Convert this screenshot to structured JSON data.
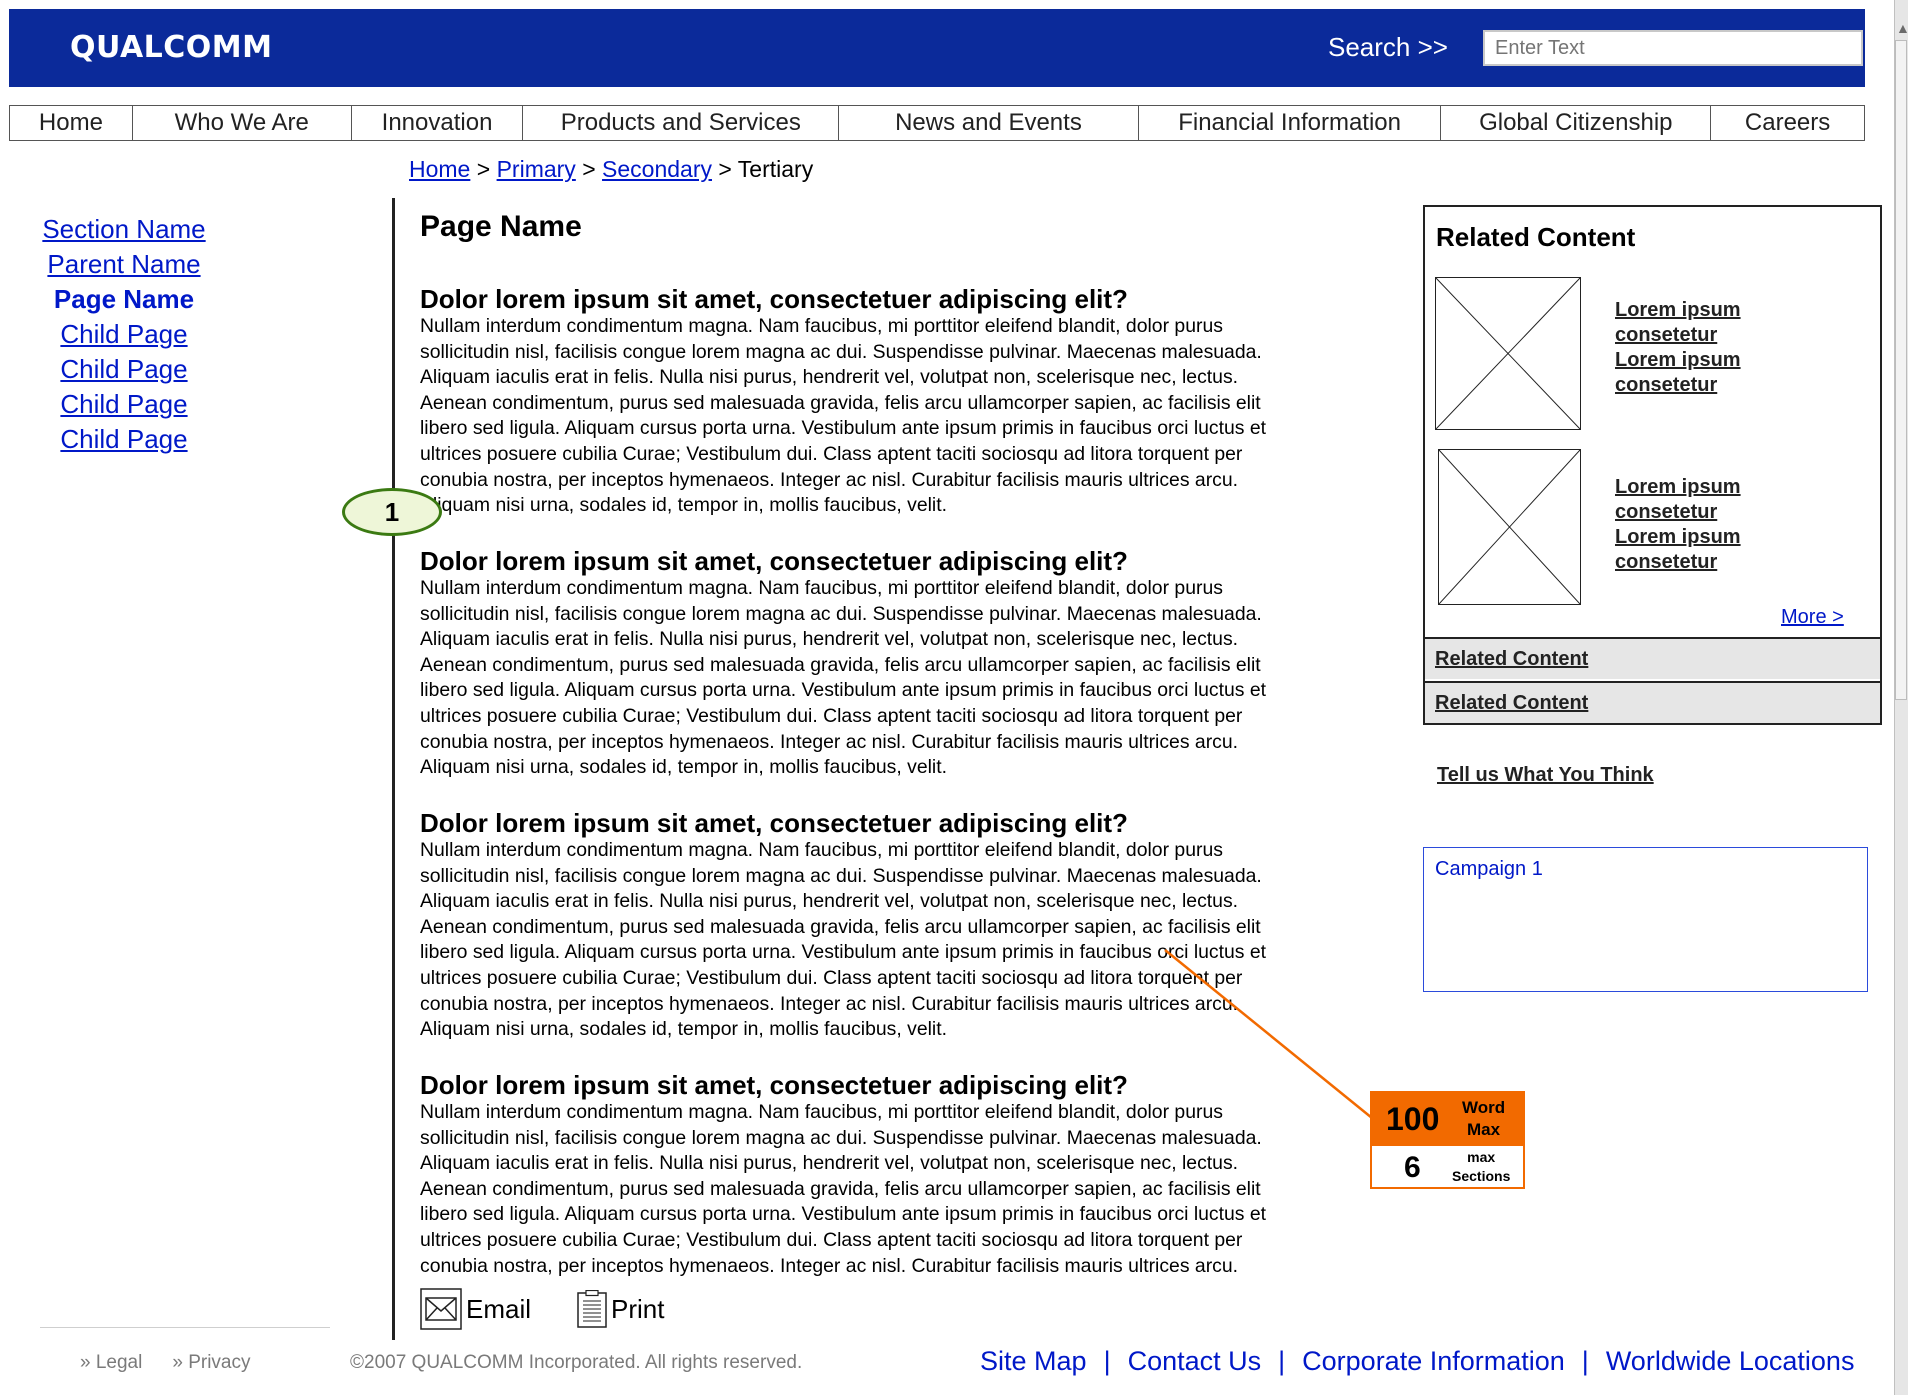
{
  "header": {
    "logo": "QUALCOMM",
    "search_label": "Search  >>",
    "search_placeholder": "Enter Text"
  },
  "nav": [
    {
      "label": "Home"
    },
    {
      "label": "Who We Are"
    },
    {
      "label": "Innovation"
    },
    {
      "label": "Products and Services"
    },
    {
      "label": "News and Events"
    },
    {
      "label": "Financial Information"
    },
    {
      "label": "Global Citizenship"
    },
    {
      "label": "Careers"
    }
  ],
  "breadcrumb": {
    "home": "Home",
    "primary": "Primary",
    "secondary": "Secondary",
    "tertiary": "Tertiary",
    "sep": " > "
  },
  "leftnav": {
    "section": "Section Name",
    "parent": "Parent Name",
    "current": "Page Name",
    "children": [
      "Child Page",
      "Child Page",
      "Child Page",
      "Child Page"
    ]
  },
  "main": {
    "page_title": "Page Name",
    "sections": [
      {
        "heading": "Dolor lorem ipsum sit amet, consectetuer adipiscing elit?",
        "lines": [
          "Nullam interdum condimentum magna. Nam faucibus, mi porttitor eleifend blandit, dolor purus",
          "sollicitudin nisl, facilisis congue lorem magna ac dui. Suspendisse pulvinar. Maecenas malesuada.",
          "Aliquam iaculis erat in felis. Nulla nisi purus, hendrerit vel, volutpat non, scelerisque nec, lectus.",
          "Aenean condimentum, purus sed malesuada gravida, felis arcu ullamcorper sapien, ac facilisis elit",
          "libero sed ligula. Aliquam cursus porta urna. Vestibulum ante ipsum primis in faucibus orci luctus et",
          "ultrices posuere cubilia Curae; Vestibulum dui. Class aptent taciti sociosqu ad litora torquent per",
          "conubia nostra, per inceptos hymenaeos. Integer ac nisl. Curabitur facilisis mauris ultrices arcu.",
          "Aliquam nisi urna, sodales id, tempor in, mollis faucibus, velit."
        ]
      },
      {
        "heading": "Dolor lorem ipsum sit amet, consectetuer adipiscing elit?",
        "lines": [
          "Nullam interdum condimentum magna. Nam faucibus, mi porttitor eleifend blandit, dolor purus",
          "sollicitudin nisl, facilisis congue lorem magna ac dui. Suspendisse pulvinar. Maecenas malesuada.",
          "Aliquam iaculis erat in felis. Nulla nisi purus, hendrerit vel, volutpat non, scelerisque nec, lectus.",
          "Aenean condimentum, purus sed malesuada gravida, felis arcu ullamcorper sapien, ac facilisis elit",
          "libero sed ligula. Aliquam cursus porta urna. Vestibulum ante ipsum primis in faucibus orci luctus et",
          "ultrices posuere cubilia Curae; Vestibulum dui. Class aptent taciti sociosqu ad litora torquent per",
          "conubia nostra, per inceptos hymenaeos. Integer ac nisl. Curabitur facilisis mauris ultrices arcu.",
          "Aliquam nisi urna, sodales id, tempor in, mollis faucibus, velit."
        ]
      },
      {
        "heading": "Dolor lorem ipsum sit amet, consectetuer adipiscing elit?",
        "lines": [
          "Nullam interdum condimentum magna. Nam faucibus, mi porttitor eleifend blandit, dolor purus",
          "sollicitudin nisl, facilisis congue lorem magna ac dui. Suspendisse pulvinar. Maecenas malesuada.",
          "Aliquam iaculis erat in felis. Nulla nisi purus, hendrerit vel, volutpat non, scelerisque nec, lectus.",
          "Aenean condimentum, purus sed malesuada gravida, felis arcu ullamcorper sapien, ac facilisis elit",
          "libero sed ligula. Aliquam cursus porta urna. Vestibulum ante ipsum primis in faucibus orci luctus et",
          "ultrices posuere cubilia Curae; Vestibulum dui. Class aptent taciti sociosqu ad litora torquent per",
          "conubia nostra, per inceptos hymenaeos. Integer ac nisl. Curabitur facilisis mauris ultrices arcu.",
          "Aliquam nisi urna, sodales id, tempor in, mollis faucibus, velit."
        ]
      },
      {
        "heading": "Dolor lorem ipsum sit amet, consectetuer adipiscing elit?",
        "lines": [
          "Nullam interdum condimentum magna. Nam faucibus, mi porttitor eleifend blandit, dolor purus",
          "sollicitudin nisl, facilisis congue lorem magna ac dui. Suspendisse pulvinar. Maecenas malesuada.",
          "Aliquam iaculis erat in felis. Nulla nisi purus, hendrerit vel, volutpat non, scelerisque nec, lectus.",
          "Aenean condimentum, purus sed malesuada gravida, felis arcu ullamcorper sapien, ac facilisis elit",
          "libero sed ligula. Aliquam cursus porta urna. Vestibulum ante ipsum primis in faucibus orci luctus et",
          "ultrices posuere cubilia Curae; Vestibulum dui. Class aptent taciti sociosqu ad litora torquent per",
          "conubia nostra, per inceptos hymenaeos. Integer ac nisl. Curabitur facilisis mauris ultrices arcu."
        ]
      }
    ],
    "email_label": "Email",
    "print_label": "Print"
  },
  "annotations": {
    "callout_number": "1",
    "word_count": "100",
    "word_label_1": "Word",
    "word_label_2": "Max",
    "sections_count": "6",
    "sections_label_1": "max",
    "sections_label_2": "Sections",
    "accent_color": "#f26a00"
  },
  "related": {
    "title": "Related Content",
    "items": [
      {
        "lines": [
          "Lorem ipsum",
          "consetetur",
          "Lorem ipsum",
          "consetetur"
        ]
      },
      {
        "lines": [
          "Lorem ipsum",
          "consetetur",
          "Lorem ipsum",
          "consetetur"
        ]
      }
    ],
    "more": "More >",
    "rows": [
      "Related Content",
      "Related Content"
    ],
    "tell_us": "Tell us What You Think",
    "campaign": "Campaign 1"
  },
  "footer": {
    "legal": "» Legal",
    "privacy": "» Privacy",
    "copyright": "©2007 QUALCOMM Incorporated. All rights reserved.",
    "links": [
      "Site Map",
      "Contact Us",
      "Corporate Information",
      "Worldwide Locations"
    ],
    "separator": "|"
  },
  "colors": {
    "header_bg": "#0b2a9a",
    "link": "#0018c8"
  }
}
